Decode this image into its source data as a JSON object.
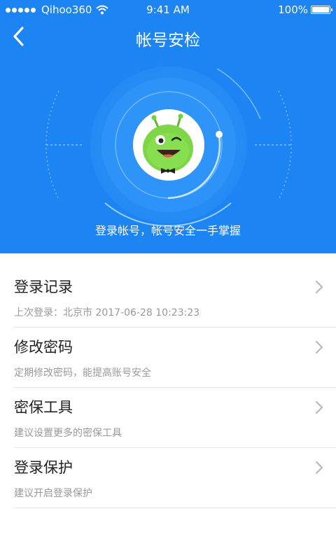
{
  "status_bar": {
    "carrier": "Qihoo360",
    "time": "9:41 AM",
    "battery": "100%",
    "signal_bars": 5,
    "icons": [
      "signal-icon",
      "wifi-icon",
      "battery-icon"
    ]
  },
  "nav": {
    "title": "帐号安检",
    "back_icon": "back-arrow-icon"
  },
  "hero": {
    "caption": "登录帐号，帐号安全一手掌握",
    "avatar_icon": "green-mascot-avatar",
    "accent_color": "#1c84f3"
  },
  "items": [
    {
      "title": "登录记录",
      "subtitle": "上次登录：北京市  2017-06-28 10:23:23"
    },
    {
      "title": "修改密码",
      "subtitle": "定期修改密码，能提高账号安全"
    },
    {
      "title": "密保工具",
      "subtitle": "建议设置更多的密保工具"
    },
    {
      "title": "登录保护",
      "subtitle": "建议开启登录保护"
    }
  ]
}
